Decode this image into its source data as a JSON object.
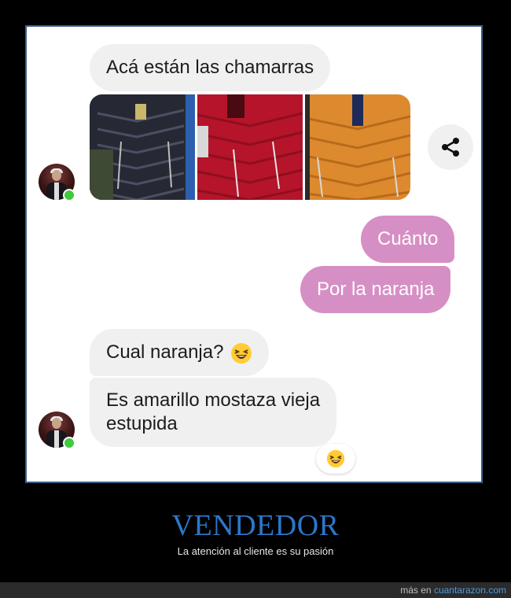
{
  "chat": {
    "messages": [
      {
        "sender": "seller",
        "text": "Acá están las chamarras"
      },
      {
        "sender": "customer",
        "text": "Cuánto"
      },
      {
        "sender": "customer",
        "text": "Por la naranja"
      },
      {
        "sender": "seller",
        "text": "Cual naranja?"
      },
      {
        "sender": "seller",
        "text_line1": "Es amarillo mostaza vieja",
        "text_line2": "estupida"
      }
    ],
    "images": [
      {
        "name": "black-jacket-photo",
        "color": "#2a2d36"
      },
      {
        "name": "red-jacket-photo",
        "color": "#c8182e"
      },
      {
        "name": "orange-jacket-photo",
        "color": "#e0892b"
      }
    ],
    "reaction_emoji": "laughing-face",
    "share_icon": "share-icon"
  },
  "caption": {
    "title": "VENDEDOR",
    "subtitle": "La atención al cliente es su pasión"
  },
  "footer": {
    "prefix": "más en",
    "site": "cuantarazon.com"
  },
  "colors": {
    "incoming_bubble": "#f0f0f1",
    "outgoing_bubble": "#d68fc4",
    "title": "#2c77c9",
    "online_indicator": "#3ecb3e"
  }
}
